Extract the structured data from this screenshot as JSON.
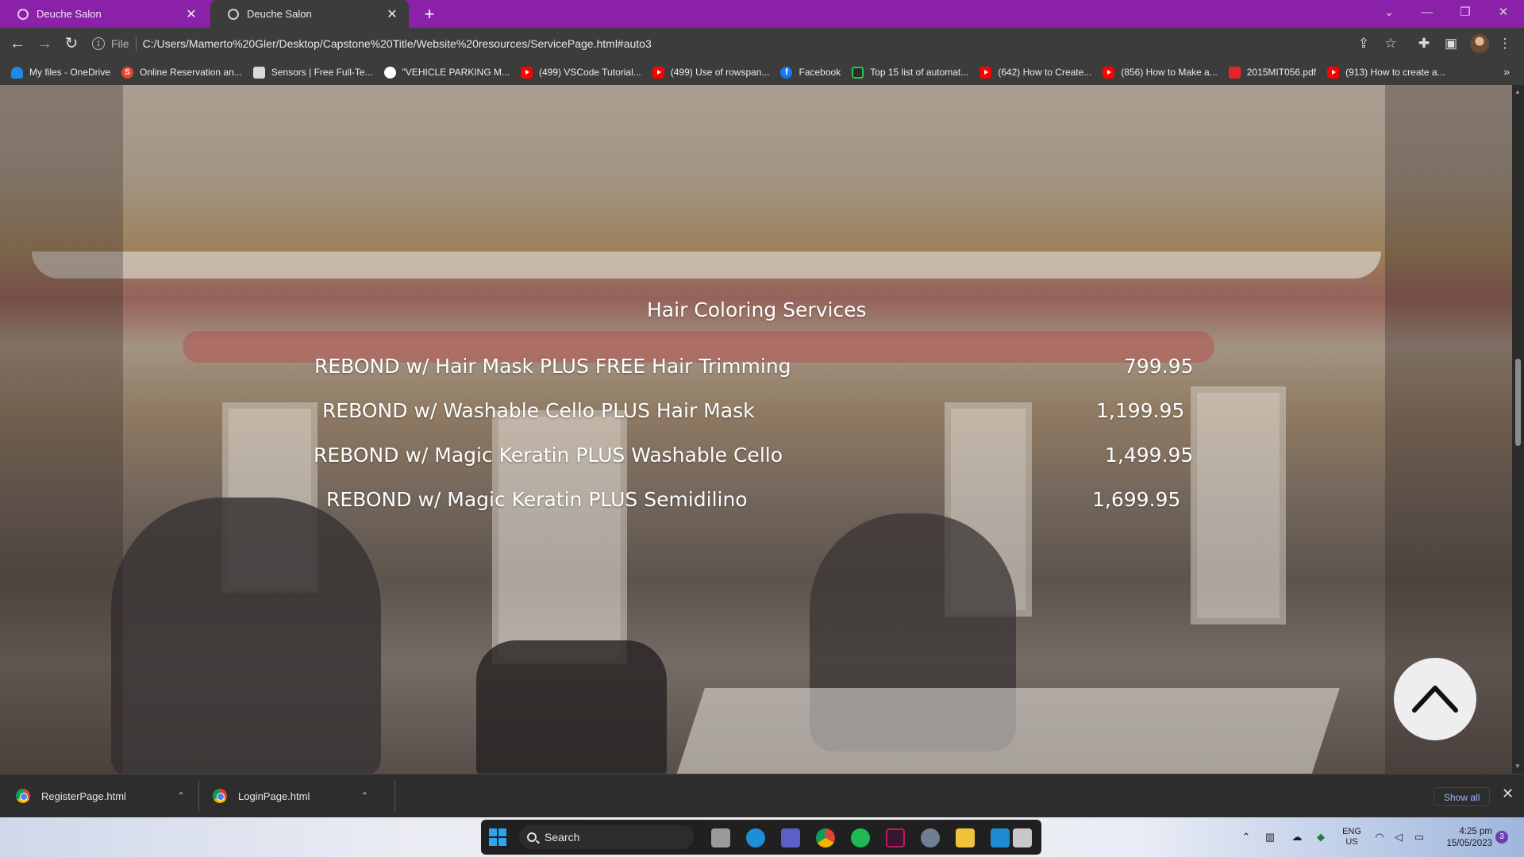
{
  "browser": {
    "tabs": [
      {
        "title": "Deuche Salon",
        "active": false
      },
      {
        "title": "Deuche Salon",
        "active": true
      }
    ],
    "new_tab_icon": "plus-icon",
    "address": {
      "scheme": "File",
      "url": "C:/Users/Mamerto%20Gler/Desktop/Capstone%20Title/Website%20resources/ServicePage.html#auto3"
    },
    "bookmarks": [
      {
        "label": "My files - OneDrive",
        "icon": "onedrive-icon"
      },
      {
        "label": "Online Reservation an...",
        "icon": "s-logo-icon"
      },
      {
        "label": "Sensors | Free Full-Te...",
        "icon": "sensors-site-icon"
      },
      {
        "label": "\"VEHICLE PARKING M...",
        "icon": "vehicle-parking-icon"
      },
      {
        "label": "(499) VSCode Tutorial...",
        "icon": "youtube-icon"
      },
      {
        "label": "(499) Use of rowspan...",
        "icon": "youtube-icon"
      },
      {
        "label": "Facebook",
        "icon": "facebook-icon"
      },
      {
        "label": "Top 15 list of automat...",
        "icon": "automation-site-icon"
      },
      {
        "label": "(642) How to Create...",
        "icon": "youtube-icon"
      },
      {
        "label": "(856) How to Make a...",
        "icon": "youtube-icon"
      },
      {
        "label": "2015MIT056.pdf",
        "icon": "pdf-icon"
      },
      {
        "label": "(913) How to create a...",
        "icon": "youtube-icon"
      }
    ],
    "bookmarks_more": "»",
    "accent_color": "#8a21a8"
  },
  "page": {
    "section_title": "Hair Coloring Services",
    "services": [
      {
        "name": "REBOND w/ Hair Mask PLUS FREE Hair Trimming",
        "price": "799.95"
      },
      {
        "name": "REBOND w/ Washable Cello PLUS Hair Mask",
        "price": "1,199.95"
      },
      {
        "name": "REBOND w/ Magic Keratin PLUS Washable Cello",
        "price": "1,499.95"
      },
      {
        "name": "REBOND w/ Magic Keratin PLUS Semidilino",
        "price": "1,699.95"
      }
    ],
    "scroll_top_icon": "chevron-up-icon"
  },
  "downloads": {
    "items": [
      {
        "filename": "RegisterPage.html"
      },
      {
        "filename": "LoginPage.html"
      }
    ],
    "show_all": "Show all"
  },
  "taskbar": {
    "search_label": "Search",
    "language": {
      "line1": "ENG",
      "line2": "US"
    },
    "time": "4:25 pm",
    "date": "15/05/2023",
    "notification_count": "3"
  }
}
